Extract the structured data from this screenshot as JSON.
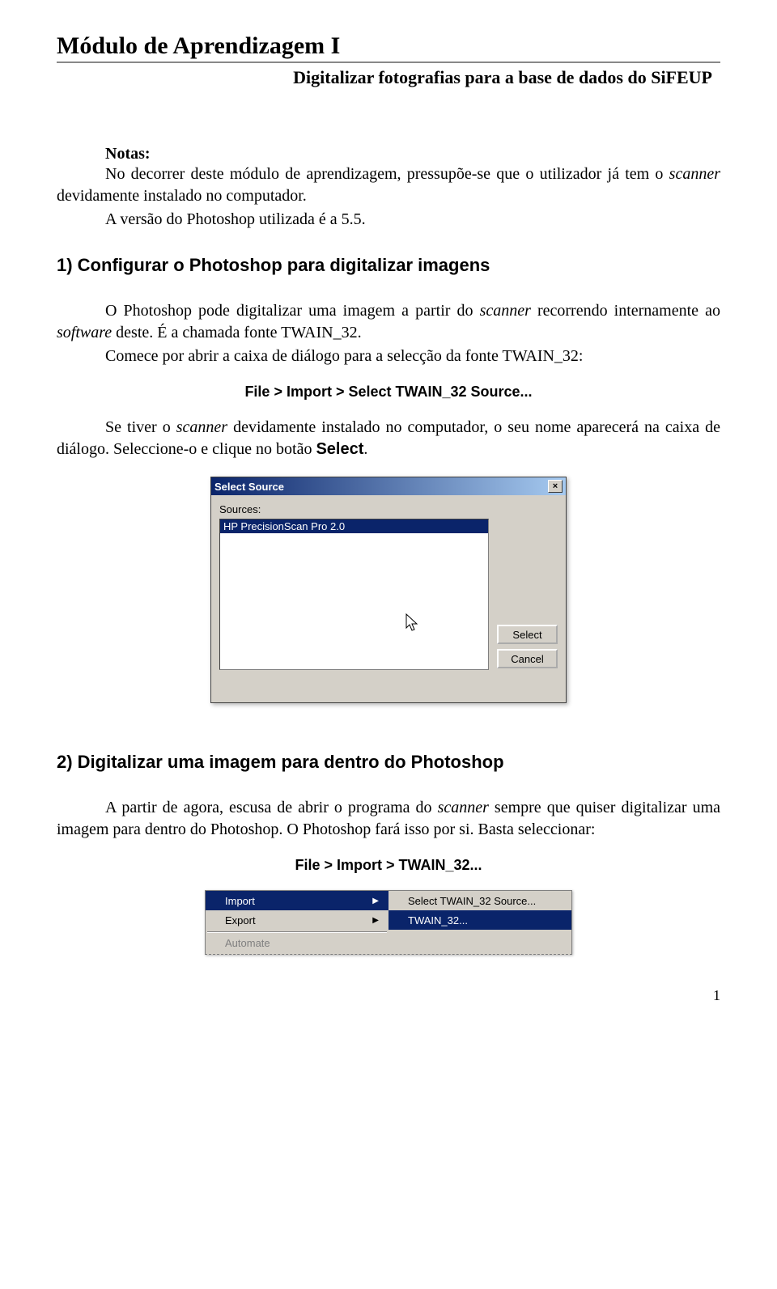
{
  "header": {
    "title": "Módulo de Aprendizagem I",
    "subtitle": "Digitalizar fotografias para a base de dados do SiFEUP"
  },
  "notas": {
    "heading": "Notas:",
    "p1a": "No decorrer deste módulo de aprendizagem, pressupõe-se que o utilizador já tem o ",
    "p1_scanner": "scanner",
    "p1b": " devidamente instalado no computador.",
    "p2": "A versão do Photoshop utilizada é a 5.5."
  },
  "section1": {
    "heading": "1)  Configurar o Photoshop para digitalizar imagens",
    "p1a": "O Photoshop pode digitalizar uma imagem a partir do ",
    "p1_scanner": "scanner",
    "p1b": " recorrendo internamente ao ",
    "p1_software": "software",
    "p1c": " deste. É a chamada fonte TWAIN_32.",
    "p2": "Comece por abrir a caixa de diálogo para a selecção da fonte TWAIN_32:",
    "instruction": "File > Import > Select TWAIN_32 Source...",
    "p3a": "Se tiver o ",
    "p3_scanner": "scanner",
    "p3b": " devidamente instalado no computador, o seu nome aparecerá na caixa de diálogo. Seleccione-o e clique no botão ",
    "p3_select": "Select",
    "p3c": "."
  },
  "dialog": {
    "title": "Select Source",
    "sources_label": "Sources:",
    "source_item": "HP PrecisionScan Pro 2.0",
    "select_btn": "Select",
    "cancel_btn": "Cancel",
    "close_x": "×"
  },
  "section2": {
    "heading": "2)  Digitalizar uma imagem para dentro do Photoshop",
    "p1a": "A partir de agora, escusa de abrir o programa do ",
    "p1_scanner": "scanner",
    "p1b": " sempre que quiser digitalizar uma imagem para dentro do Photoshop. O Photoshop fará isso por si. Basta seleccionar:",
    "instruction": "File > Import > TWAIN_32..."
  },
  "menu": {
    "left": {
      "import": "Import",
      "export": "Export",
      "automate": "Automate"
    },
    "right": {
      "select_source": "Select TWAIN_32 Source...",
      "twain": "TWAIN_32..."
    },
    "arrow": "▶"
  },
  "page_number": "1"
}
